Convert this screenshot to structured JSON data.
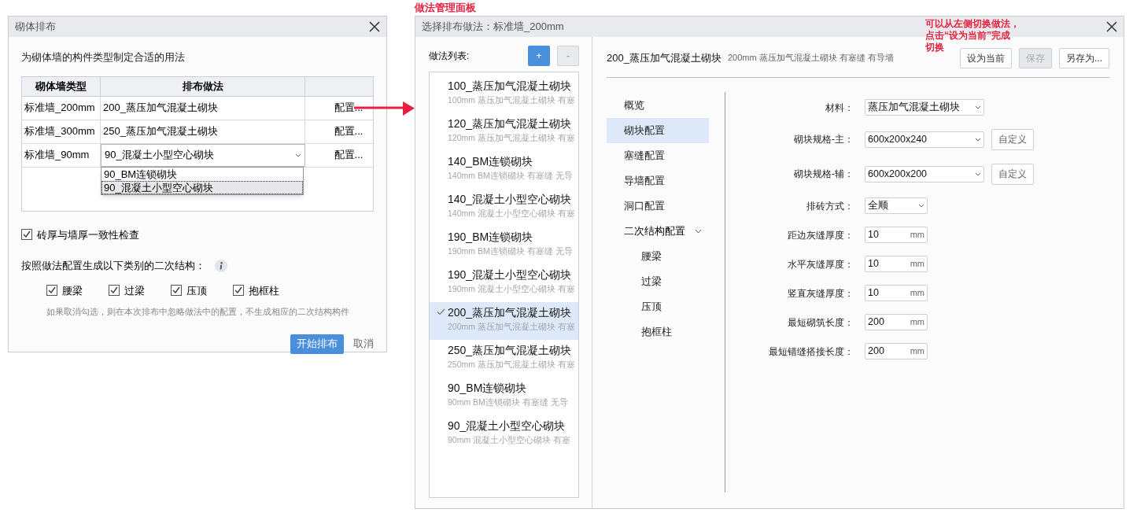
{
  "layout_dialog": {
    "title": "砌体排布",
    "description": "为砌体墙的构件类型制定合适的用法",
    "table": {
      "columns": [
        "砌体墙类型",
        "排布做法"
      ],
      "rows": [
        {
          "kind": "text",
          "wall_type": "标准墙_200mm",
          "method": "200_蒸压加气混凝土砌块",
          "action": "配置..."
        },
        {
          "kind": "text",
          "wall_type": "标准墙_300mm",
          "method": "250_蒸压加气混凝土砌块",
          "action": "配置..."
        },
        {
          "kind": "select",
          "wall_type": "标准墙_90mm",
          "method": "90_混凝土小型空心砌块",
          "action": "配置...",
          "open": true,
          "options": [
            {
              "label": "90_BM连锁砌块",
              "selected": false
            },
            {
              "label": "90_混凝土小型空心砌块",
              "selected": true
            }
          ]
        }
      ]
    },
    "consistency_check": {
      "label": "砖厚与墙厚一致性检查",
      "checked": true
    },
    "structures_label": "按照做法配置生成以下类别的二次结构：",
    "structures": [
      {
        "label": "腰梁",
        "checked": true
      },
      {
        "label": "过梁",
        "checked": true
      },
      {
        "label": "压顶",
        "checked": true
      },
      {
        "label": "抱框柱",
        "checked": true
      }
    ],
    "note": "如果取消勾选，则在本次排布中忽略做法中的配置，不生成相应的二次结构构件",
    "buttons": [
      {
        "label": "开始排布",
        "primary": true
      },
      {
        "label": "取消",
        "primary": false
      }
    ]
  },
  "annotations": {
    "panel_caption": "做法管理面板",
    "hint_lines": [
      "可以从左侧切换做法，",
      "点击“设为当前”完成",
      "切换"
    ]
  },
  "method_dialog": {
    "title": "选择排布做法：标准墙_200mm",
    "list_label": "做法列表:",
    "list_buttons": [
      {
        "label": "+",
        "disabled": false
      },
      {
        "label": "-",
        "disabled": true
      }
    ],
    "methods": [
      {
        "name": "100_蒸压加气混凝土砌块",
        "description": "100mm 蒸压加气混凝土砌块 有塞",
        "selected": false
      },
      {
        "name": "120_蒸压加气混凝土砌块",
        "description": "120mm 蒸压加气混凝土砌块 有塞",
        "selected": false
      },
      {
        "name": "140_BM连锁砌块",
        "description": "140mm BM连锁砌块 有塞缝 无导",
        "selected": false
      },
      {
        "name": "140_混凝土小型空心砌块",
        "description": "140mm 混凝土小型空心砌块 有塞",
        "selected": false
      },
      {
        "name": "190_BM连锁砌块",
        "description": "190mm BM连锁砌块 有塞缝 无导",
        "selected": false
      },
      {
        "name": "190_混凝土小型空心砌块",
        "description": "190mm 混凝土小型空心砌块 有塞",
        "selected": false
      },
      {
        "name": "200_蒸压加气混凝土砌块",
        "description": "200mm 蒸压加气混凝土砌块 有塞",
        "selected": true
      },
      {
        "name": "250_蒸压加气混凝土砌块",
        "description": "250mm 蒸压加气混凝土砌块 有塞",
        "selected": false
      },
      {
        "name": "90_BM连锁砌块",
        "description": "90mm BM连锁砌块 有塞缝 无导",
        "selected": false
      },
      {
        "name": "90_混凝土小型空心砌块",
        "description": "90mm 混凝土小型空心砌块 有塞",
        "selected": false
      }
    ],
    "header": {
      "name": "200_蒸压加气混凝土砌块",
      "description": "200mm 蒸压加气混凝土砌块 有塞缝 有导墙",
      "buttons": [
        {
          "label": "设为当前",
          "disabled": false
        },
        {
          "label": "保存",
          "disabled": true
        },
        {
          "label": "另存为...",
          "disabled": false
        }
      ]
    },
    "nav": [
      {
        "label": "概览",
        "selected": false
      },
      {
        "label": "砌块配置",
        "selected": true
      },
      {
        "label": "塞缝配置",
        "selected": false
      },
      {
        "label": "导墙配置",
        "selected": false
      },
      {
        "label": "洞口配置",
        "selected": false
      },
      {
        "label": "二次结构配置",
        "selected": false,
        "expanded": true,
        "children": [
          {
            "label": "腰梁",
            "selected": false
          },
          {
            "label": "过梁",
            "selected": false
          },
          {
            "label": "压顶",
            "selected": false
          },
          {
            "label": "抱框柱",
            "selected": false
          }
        ]
      }
    ],
    "fields": [
      {
        "kind": "dropdown",
        "label": "材料：",
        "value": "蒸压加气混凝土砌块"
      },
      {
        "kind": "dropdown",
        "label": "砌块规格-主：",
        "value": "600x200x240",
        "button": "自定义"
      },
      {
        "kind": "dropdown",
        "label": "砌块规格-辅：",
        "value": "600x200x200",
        "button": "自定义"
      },
      {
        "kind": "compact-dropdown",
        "label": "排砖方式：",
        "value": "全顺"
      },
      {
        "kind": "number",
        "label": "距边灰缝厚度：",
        "value": "10",
        "unit": "mm"
      },
      {
        "kind": "number",
        "label": "水平灰缝厚度：",
        "value": "10",
        "unit": "mm"
      },
      {
        "kind": "number",
        "label": "竖直灰缝厚度：",
        "value": "10",
        "unit": "mm"
      },
      {
        "kind": "number",
        "label": "最短砌筑长度：",
        "value": "200",
        "unit": "mm"
      },
      {
        "kind": "number",
        "label": "最短错缝搭接长度：",
        "value": "200",
        "unit": "mm"
      }
    ]
  }
}
